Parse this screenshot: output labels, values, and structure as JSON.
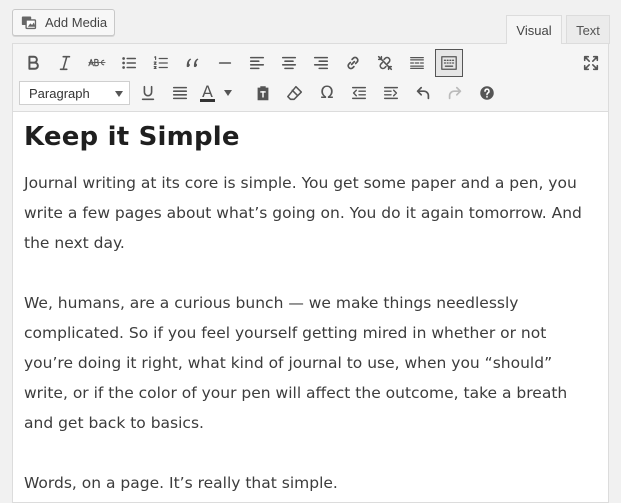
{
  "add_media": {
    "label": "Add Media"
  },
  "tabs": [
    {
      "label": "Visual",
      "active": true
    },
    {
      "label": "Text",
      "active": false
    }
  ],
  "toolbar": {
    "row1": [
      "bold-icon",
      "italic-icon",
      "strikethrough-icon",
      "bulleted-list-icon",
      "numbered-list-icon",
      "blockquote-icon",
      "horizontal-line-icon",
      "align-left-icon",
      "align-center-icon",
      "align-right-icon",
      "insert-link-icon",
      "remove-link-icon",
      "read-more-icon",
      "toolbar-toggle-icon"
    ],
    "row2": [
      "underline-icon",
      "justify-icon",
      "text-color-icon",
      "paste-as-text-icon",
      "clear-formatting-icon",
      "special-character-icon",
      "decrease-indent-icon",
      "increase-indent-icon",
      "undo-icon",
      "redo-icon",
      "help-icon"
    ],
    "format_value": "Paragraph",
    "text_color_glyph": "A",
    "special_char_glyph": "Ω"
  },
  "content": {
    "heading": "Keep it Simple",
    "paragraphs": [
      "Journal writing at its core is simple. You get some paper and a pen, you write a few pages about what’s going on. You do it again tomorrow. And the next day.",
      "We, humans, are a curious bunch — we make things needlessly complicated. So if you feel yourself getting mired in whether or not you’re doing it right, what kind of journal to use, when you “should” write, or if the color of your pen will affect the outcome, take a breath and get back to basics.",
      "Words, on a page. It’s really that simple."
    ]
  },
  "colors": {
    "accent": "#555555",
    "background": "#f1f1f1",
    "editor_bg": "#ffffff"
  }
}
